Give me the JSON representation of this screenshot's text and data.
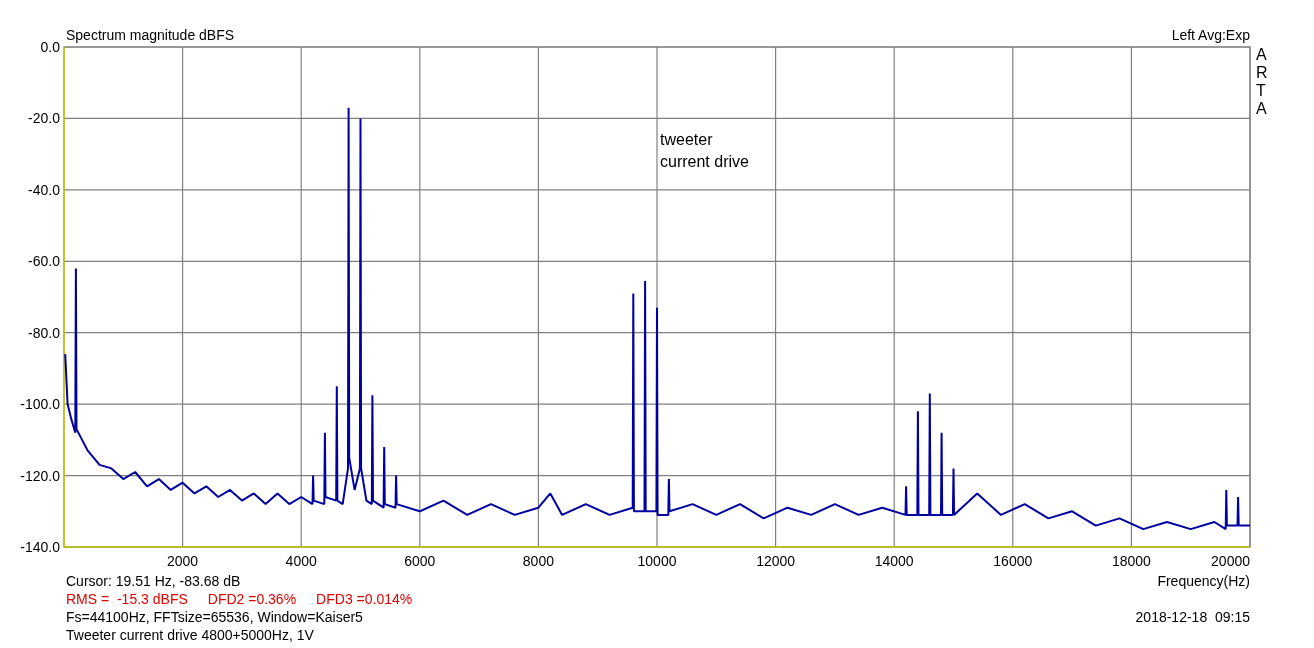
{
  "plot": {
    "channel_info": "Left  Avg:Exp",
    "logo": "ARTA",
    "chart_data": {
      "type": "line",
      "title": "Spectrum magnitude dBFS",
      "xlabel": "Frequency(Hz)",
      "xlim": [
        0,
        20000
      ],
      "ylim": [
        -140,
        0
      ],
      "xticks": [
        2000,
        4000,
        6000,
        8000,
        10000,
        12000,
        14000,
        16000,
        18000,
        20000
      ],
      "yticks": [
        {
          "value": 0,
          "label": "0.0"
        },
        {
          "value": -20,
          "label": "-20.0"
        },
        {
          "value": -40,
          "label": "-40.0"
        },
        {
          "value": -60,
          "label": "-60.0"
        },
        {
          "value": -80,
          "label": "-80.0"
        },
        {
          "value": -100,
          "label": "-100.0"
        },
        {
          "value": -120,
          "label": "-120.0"
        },
        {
          "value": -140,
          "label": "-140.0"
        }
      ],
      "x": [
        20,
        60,
        120,
        190,
        200,
        210,
        400,
        600,
        800,
        1000,
        1200,
        1400,
        1600,
        1800,
        2000,
        2200,
        2400,
        2600,
        2800,
        3000,
        3200,
        3400,
        3600,
        3800,
        4000,
        4190,
        4200,
        4210,
        4390,
        4400,
        4410,
        4590,
        4600,
        4610,
        4700,
        4790,
        4800,
        4810,
        4900,
        4990,
        5000,
        5010,
        5100,
        5190,
        5200,
        5210,
        5390,
        5400,
        5410,
        5590,
        5600,
        5610,
        6000,
        6400,
        6800,
        7200,
        7600,
        8000,
        8200,
        8400,
        8800,
        9200,
        9590,
        9600,
        9610,
        9790,
        9800,
        9810,
        9990,
        10000,
        10010,
        10190,
        10200,
        10210,
        10600,
        11000,
        11400,
        11800,
        12200,
        12600,
        13000,
        13400,
        13800,
        14190,
        14200,
        14210,
        14390,
        14400,
        14410,
        14590,
        14600,
        14610,
        14790,
        14800,
        14810,
        14990,
        15000,
        15010,
        15400,
        15800,
        16200,
        16600,
        17000,
        17400,
        17800,
        18200,
        18600,
        19000,
        19400,
        19590,
        19600,
        19610,
        19790,
        19800,
        19810,
        20000
      ],
      "series": [
        {
          "color": "#0000a0",
          "values": [
            -86,
            -100,
            -104,
            -108,
            -62,
            -107,
            -113,
            -117,
            -118,
            -121,
            -119,
            -123,
            -121,
            -124,
            -122,
            -125,
            -123,
            -126,
            -124,
            -127,
            -125,
            -128,
            -125,
            -128,
            -126,
            -128,
            -120,
            -127,
            -128,
            -108,
            -126,
            -127,
            -95,
            -127,
            -128,
            -118,
            -17,
            -115,
            -124,
            -118,
            -20,
            -118,
            -127,
            -128,
            -97.5,
            -127,
            -129,
            -112,
            -128,
            -129,
            -120,
            -128,
            -130,
            -127,
            -131,
            -128,
            -131,
            -129,
            -125,
            -131,
            -128,
            -131,
            -129,
            -69,
            -130,
            -130,
            -65.5,
            -130,
            -130,
            -73,
            -131,
            -131,
            -121,
            -130,
            -128,
            -131,
            -128,
            -132,
            -129,
            -131,
            -128,
            -131,
            -129,
            -131,
            -123,
            -131,
            -131,
            -102,
            -131,
            -131,
            -97,
            -131,
            -131,
            -108,
            -131,
            -131,
            -118,
            -131,
            -125,
            -131,
            -128,
            -132,
            -130,
            -134,
            -132,
            -135,
            -133,
            -135,
            -133,
            -135,
            -124,
            -134,
            -134,
            -126,
            -134,
            -134
          ]
        }
      ],
      "grid": true,
      "annotations": [
        "tweeter",
        "current drive"
      ]
    }
  },
  "footer": {
    "cursor": "Cursor: 19.51 Hz, -83.68 dB",
    "measurements": [
      "RMS =  -15.3 dBFS",
      "DFD2 =0.36%",
      "DFD3 =0.014%"
    ],
    "settings": "Fs=44100Hz, FFTsize=65536, Window=Kaiser5",
    "description": "Tweeter current drive 4800+5000Hz, 1V",
    "timestamp": "2018-12-18  09:15"
  }
}
